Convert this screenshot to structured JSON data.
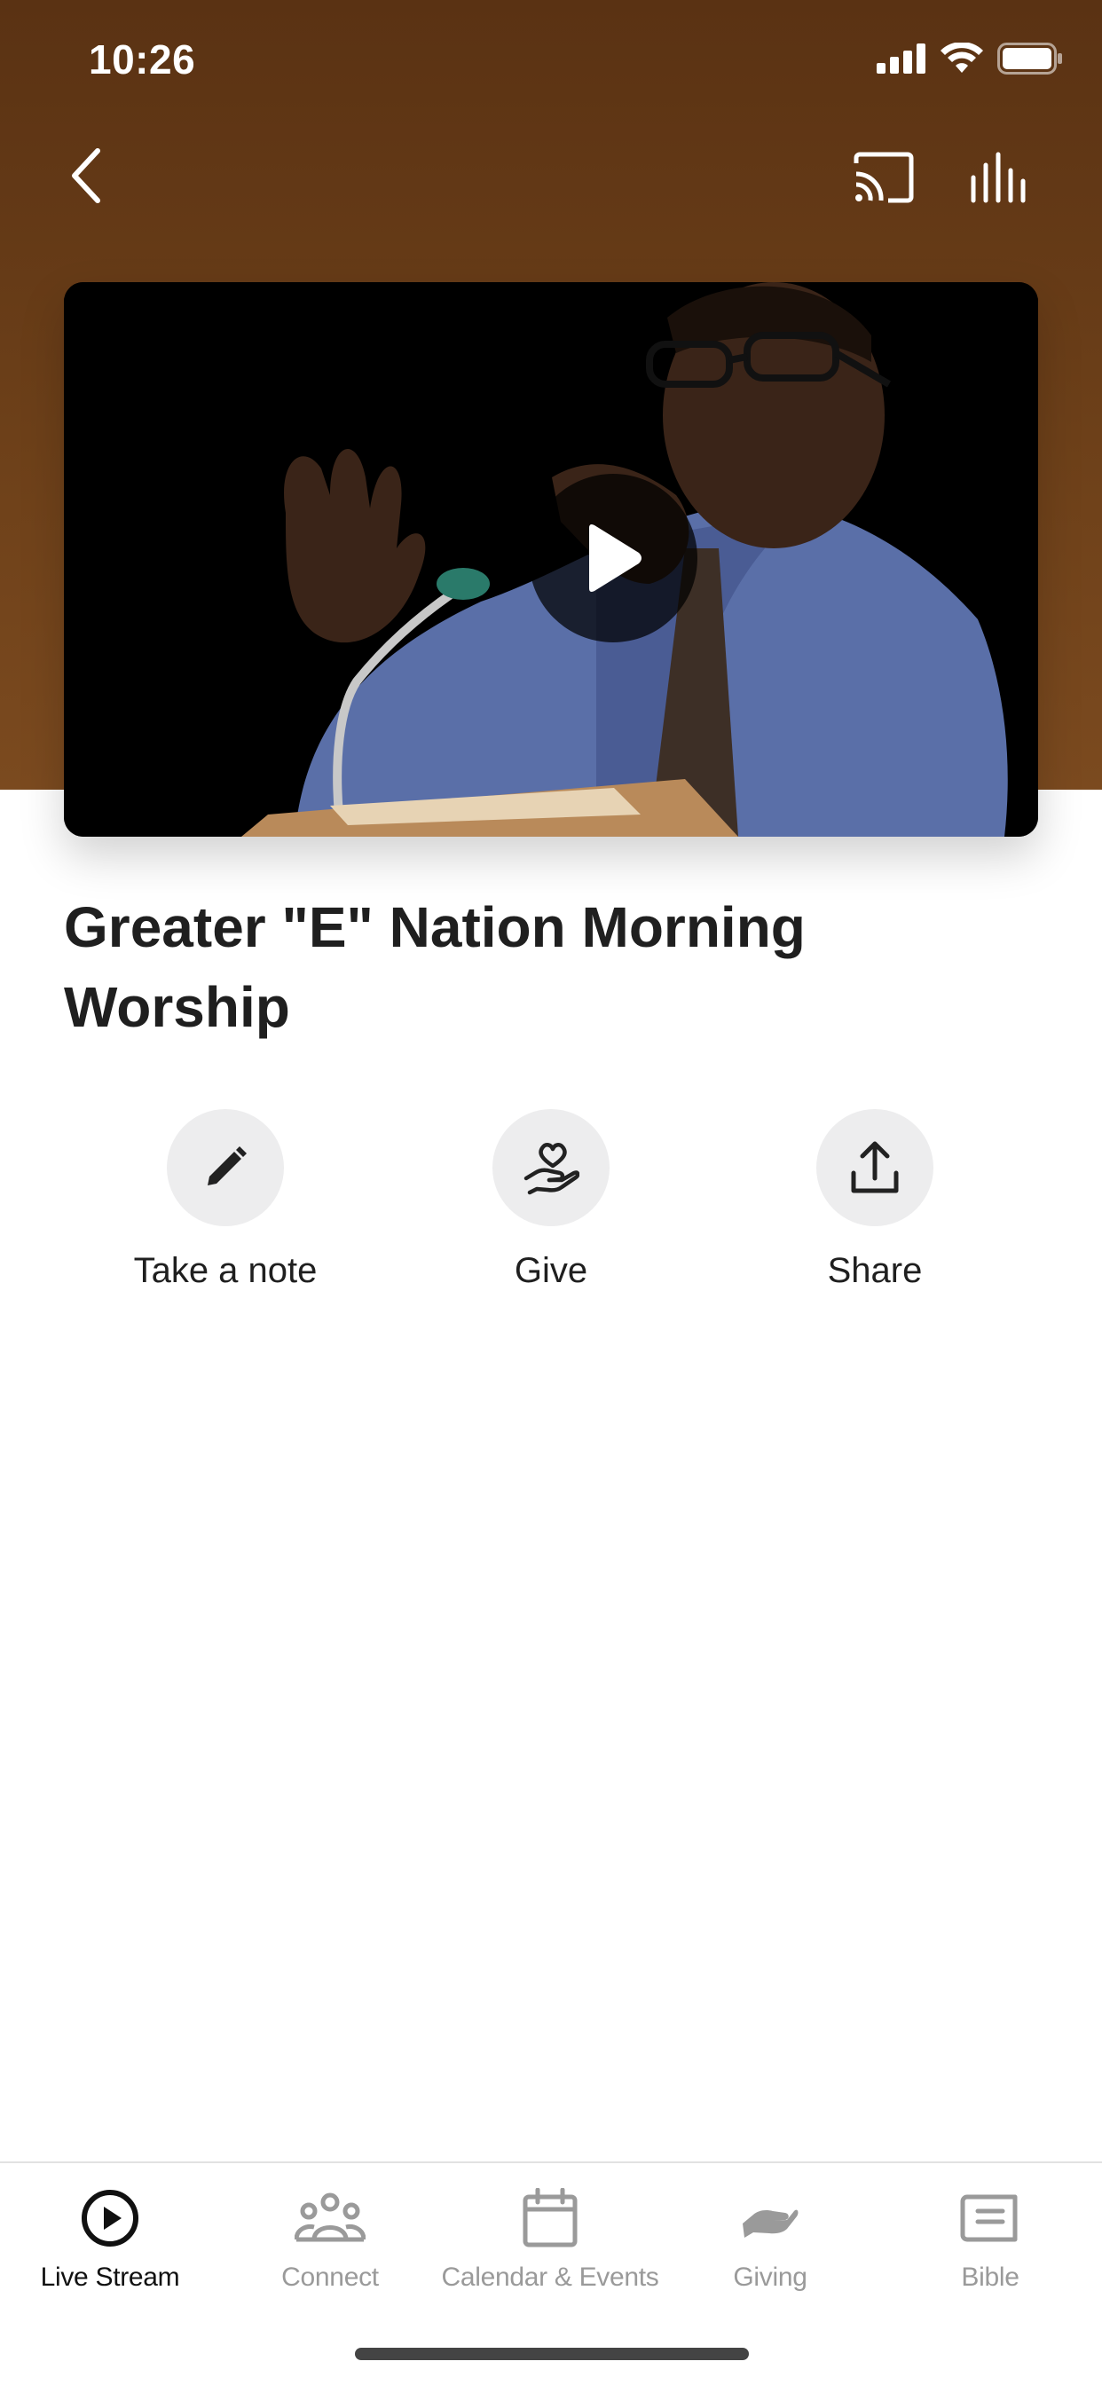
{
  "status_bar": {
    "time": "10:26",
    "icons": [
      "cellular-signal-icon",
      "wifi-icon",
      "battery-icon"
    ]
  },
  "nav": {
    "back_icon": "chevron-left-icon",
    "cast_icon": "cast-icon",
    "audio_icon": "audio-bars-icon"
  },
  "video": {
    "play_icon": "play-icon",
    "thumbnail": "preacher-at-pulpit"
  },
  "title": "Greater \"E\" Nation Morning Worship",
  "actions": [
    {
      "label": "Take a note",
      "icon": "pencil-icon"
    },
    {
      "label": "Give",
      "icon": "heart-hand-icon"
    },
    {
      "label": "Share",
      "icon": "share-upload-icon"
    }
  ],
  "tabs": [
    {
      "label": "Live Stream",
      "icon": "play-circle-icon",
      "active": true
    },
    {
      "label": "Connect",
      "icon": "people-group-icon",
      "active": false
    },
    {
      "label": "Calendar & Events",
      "icon": "calendar-icon",
      "active": false
    },
    {
      "label": "Giving",
      "icon": "giving-hand-icon",
      "active": false
    },
    {
      "label": "Bible",
      "icon": "book-icon",
      "active": false
    }
  ],
  "colors": {
    "header_brown": "#6d4019",
    "text_primary": "#1f1f1f",
    "tab_inactive": "#9a9a9a",
    "action_circle": "#ededee"
  }
}
